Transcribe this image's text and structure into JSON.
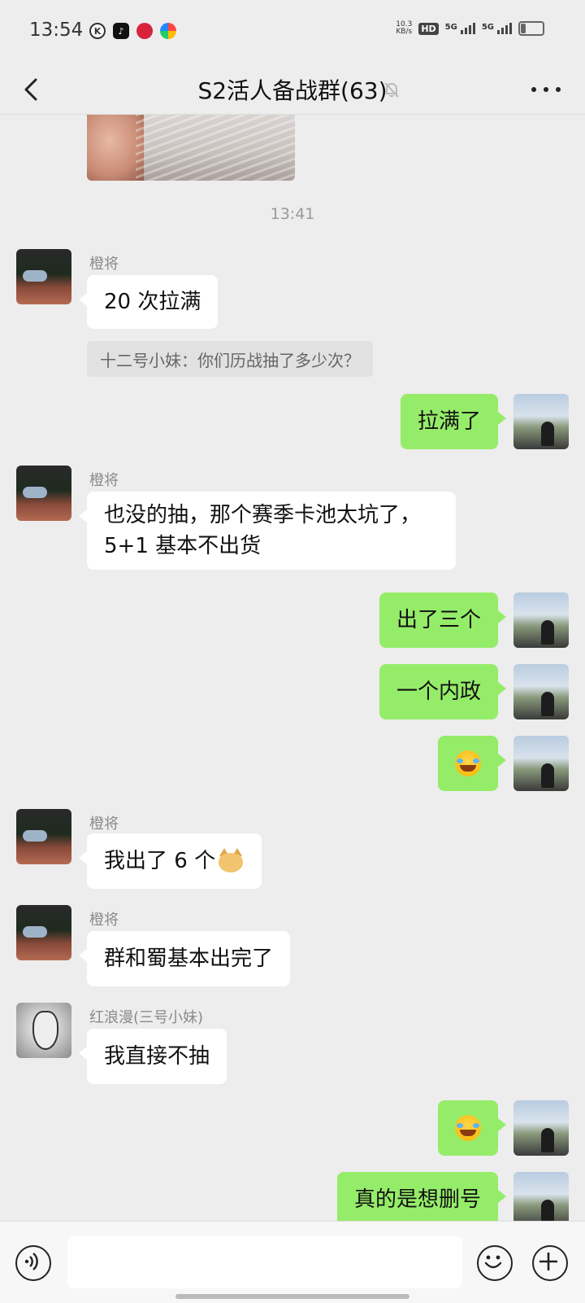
{
  "status_bar": {
    "time": "13:54",
    "speed_value": "10.3",
    "speed_unit": "KB/s",
    "hd_label": "HD",
    "network_1": "5G",
    "network_2": "5G",
    "battery_level": 0.25
  },
  "header": {
    "title": "S2活人备战群(63)",
    "muted": true
  },
  "messages": [
    {
      "type": "image",
      "direction": "in"
    },
    {
      "type": "timestamp",
      "text": "13:41"
    },
    {
      "type": "text",
      "direction": "in",
      "sender": "橙将",
      "text": "20 次拉满"
    },
    {
      "type": "quote",
      "text": "十二号小妹：你们历战抽了多少次？"
    },
    {
      "type": "text",
      "direction": "out",
      "text": "拉满了"
    },
    {
      "type": "text",
      "direction": "in",
      "sender": "橙将",
      "lines": [
        "也没的抽，那个赛季卡池太坑了，",
        "5+1 基本不出货"
      ]
    },
    {
      "type": "text",
      "direction": "out",
      "text": "出了三个"
    },
    {
      "type": "text",
      "direction": "out",
      "text": "一个内政"
    },
    {
      "type": "emoji",
      "direction": "out",
      "emoji": "laughing-tears"
    },
    {
      "type": "text",
      "direction": "in",
      "sender": "橙将",
      "text": "我出了 6 个",
      "emoji": "doge"
    },
    {
      "type": "text",
      "direction": "in",
      "sender": "橙将",
      "text": "群和蜀基本出完了"
    },
    {
      "type": "text",
      "direction": "in",
      "sender": "红浪漫(三号小妹)",
      "text": "我直接不抽"
    },
    {
      "type": "emoji",
      "direction": "out",
      "emoji": "laughing-tears"
    },
    {
      "type": "text",
      "direction": "out",
      "text": "真的是想删号"
    }
  ],
  "input_bar": {
    "value": "",
    "icons": [
      "voice-icon",
      "emoji-icon",
      "plus-icon"
    ]
  },
  "colors": {
    "background": "#ededed",
    "outgoing_bubble": "#95ec69",
    "incoming_bubble": "#ffffff"
  }
}
